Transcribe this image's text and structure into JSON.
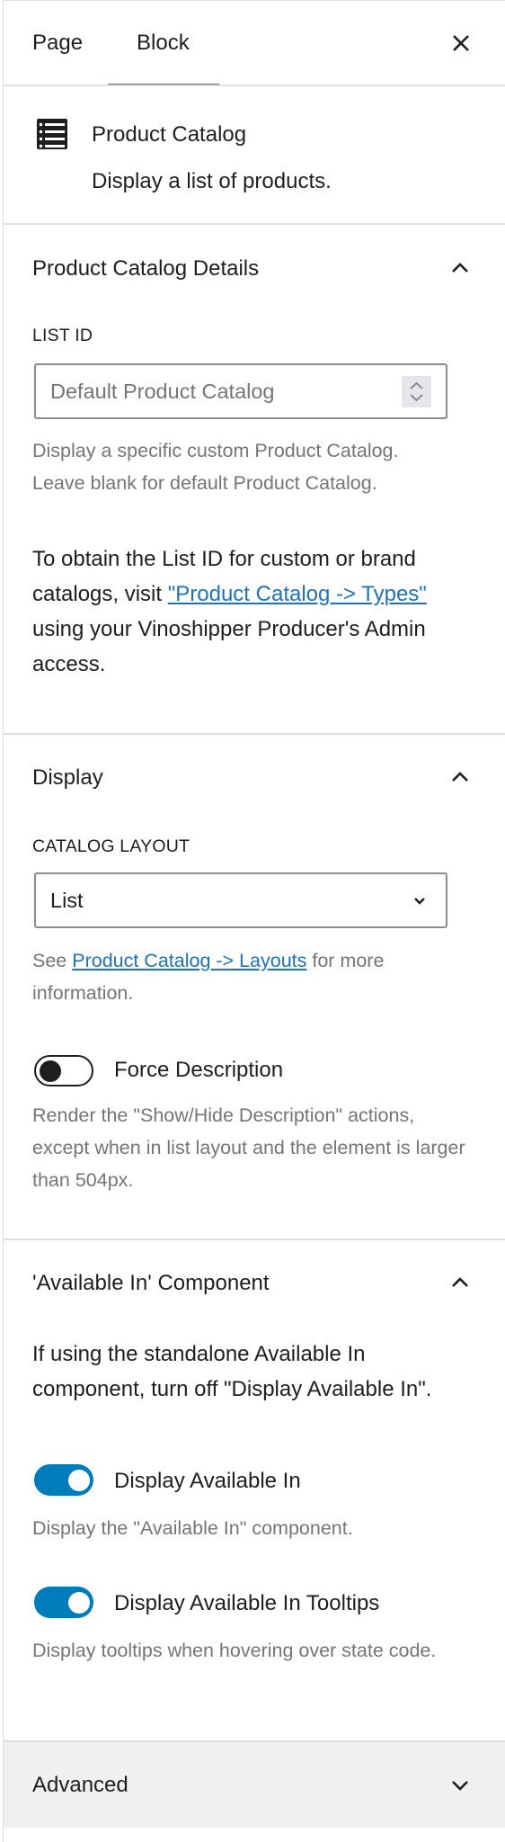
{
  "tabs": [
    {
      "label": "Page",
      "active": false
    },
    {
      "label": "Block",
      "active": true
    }
  ],
  "close_label": "Close settings",
  "block": {
    "icon": "list-view-icon",
    "title": "Product Catalog",
    "description": "Display a list of products."
  },
  "details": {
    "title": "Product Catalog Details",
    "expanded": true,
    "list_id_label": "LIST ID",
    "list_id_value": "",
    "list_id_placeholder": "Default Product Catalog",
    "help_line1": "Display a specific custom Product Catalog.",
    "help_line2": "Leave blank for default Product Catalog.",
    "para_before_link": "To obtain the List ID for custom or brand catalogs, visit ",
    "para_link": "\"Product Catalog -> Types\"",
    "para_after_link": " using your Vinoshipper Producer's Admin access."
  },
  "display": {
    "title": "Display",
    "expanded": true,
    "layout_label": "CATALOG LAYOUT",
    "layout_value": "List",
    "help_before_link": "See ",
    "help_link": "Product Catalog -> Layouts",
    "help_after_link": " for more information.",
    "force_description": {
      "label": "Force Description",
      "checked": false,
      "help": "Render the \"Show/Hide Description\" actions, except when in list layout and the element is larger than 504px."
    }
  },
  "available": {
    "title": "'Available In' Component",
    "expanded": true,
    "intro": "If using the standalone Available In component, turn off \"Display Available In\".",
    "toggles": [
      {
        "label": "Display Available In",
        "checked": true,
        "help": "Display the \"Available In\" component."
      },
      {
        "label": "Display Available In Tooltips",
        "checked": true,
        "help": "Display tooltips when hovering over state code."
      }
    ]
  },
  "advanced": {
    "title": "Advanced",
    "expanded": false
  },
  "colors": {
    "accent": "#007cba",
    "link": "#2271b1",
    "tab_indicator": "#1e73be",
    "help_text": "#757575",
    "advanced_bg": "#f0f0f0"
  }
}
